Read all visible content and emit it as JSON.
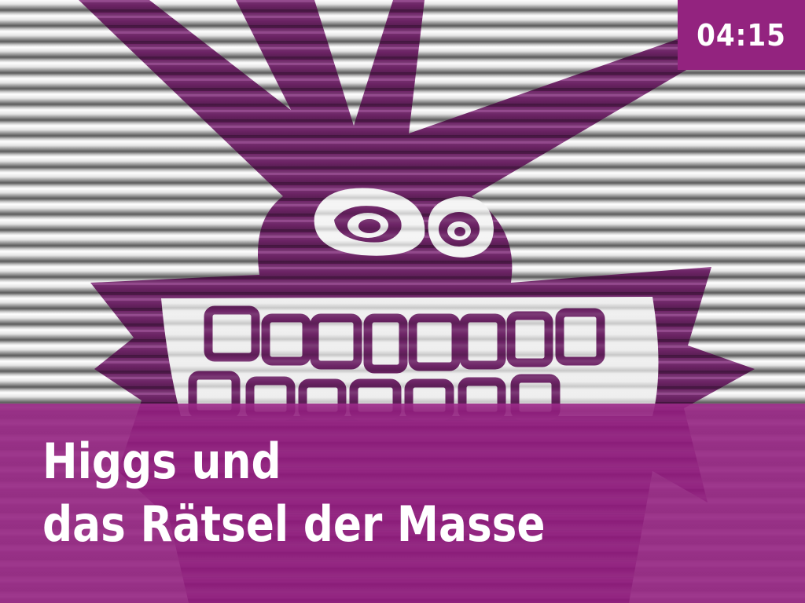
{
  "screen": {
    "timer": "04:15",
    "title": {
      "line1": "Higgs und",
      "line2": "das Rätsel der Masse"
    }
  },
  "graphic": {
    "icon": "grinning-monster-icon",
    "monster_color": "#6d2466",
    "background_style": "corrugated-metal-stripes"
  },
  "colors": {
    "accent": "#93237f",
    "banner": "#961e82",
    "text": "#ffffff"
  }
}
